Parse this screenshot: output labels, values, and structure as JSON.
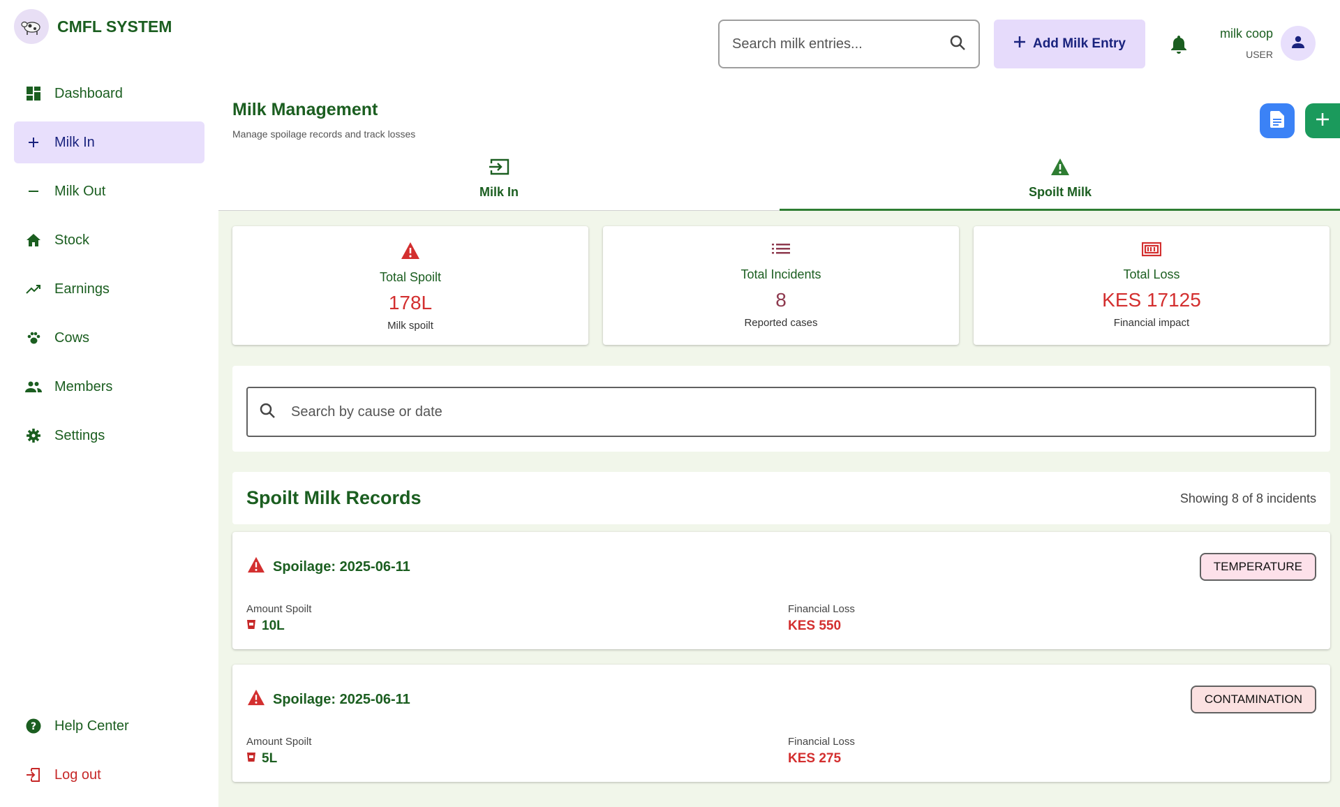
{
  "app": {
    "name": "CMFL SYSTEM"
  },
  "sidebar": {
    "items": [
      {
        "label": "Dashboard",
        "icon": "dashboard-icon"
      },
      {
        "label": "Milk In",
        "icon": "plus-icon",
        "active": true
      },
      {
        "label": "Milk Out",
        "icon": "minus-icon"
      },
      {
        "label": "Stock",
        "icon": "home-icon"
      },
      {
        "label": "Earnings",
        "icon": "trending-up-icon"
      },
      {
        "label": "Cows",
        "icon": "paw-icon"
      },
      {
        "label": "Members",
        "icon": "people-icon"
      },
      {
        "label": "Settings",
        "icon": "gear-icon"
      }
    ],
    "bottom": [
      {
        "label": "Help Center",
        "icon": "help-icon"
      },
      {
        "label": "Log out",
        "icon": "logout-icon"
      }
    ]
  },
  "topbar": {
    "search_placeholder": "Search milk entries...",
    "add_label": "Add Milk Entry",
    "user_name": "milk coop",
    "user_role": "USER"
  },
  "page": {
    "title": "Milk Management",
    "subtitle": "Manage spoilage records and track losses"
  },
  "tabs": [
    {
      "label": "Milk In",
      "icon": "input-icon"
    },
    {
      "label": "Spoilt Milk",
      "icon": "warning-icon",
      "active": true
    }
  ],
  "stats": [
    {
      "label": "Total Spoilt",
      "value": "178L",
      "note": "Milk spoilt",
      "icon": "warning-icon"
    },
    {
      "label": "Total Incidents",
      "value": "8",
      "note": "Reported cases",
      "icon": "list-icon"
    },
    {
      "label": "Total Loss",
      "value": "KES 17125",
      "note": "Financial impact",
      "icon": "money-icon"
    }
  ],
  "filter": {
    "placeholder": "Search by cause or date"
  },
  "records": {
    "title": "Spoilt Milk Records",
    "count": "Showing 8 of 8 incidents",
    "amount_label": "Amount Spoilt",
    "loss_label": "Financial Loss",
    "items": [
      {
        "title": "Spoilage: 2025-06-11",
        "cause": "TEMPERATURE",
        "amount": "10L",
        "loss": "KES 550"
      },
      {
        "title": "Spoilage: 2025-06-11",
        "cause": "CONTAMINATION",
        "amount": "5L",
        "loss": "KES 275"
      }
    ]
  },
  "colors": {
    "brand_green": "#1b5e20",
    "accent_purple": "#e8dffc",
    "danger_red": "#d32f2f",
    "content_bg": "#f1f6ea"
  }
}
